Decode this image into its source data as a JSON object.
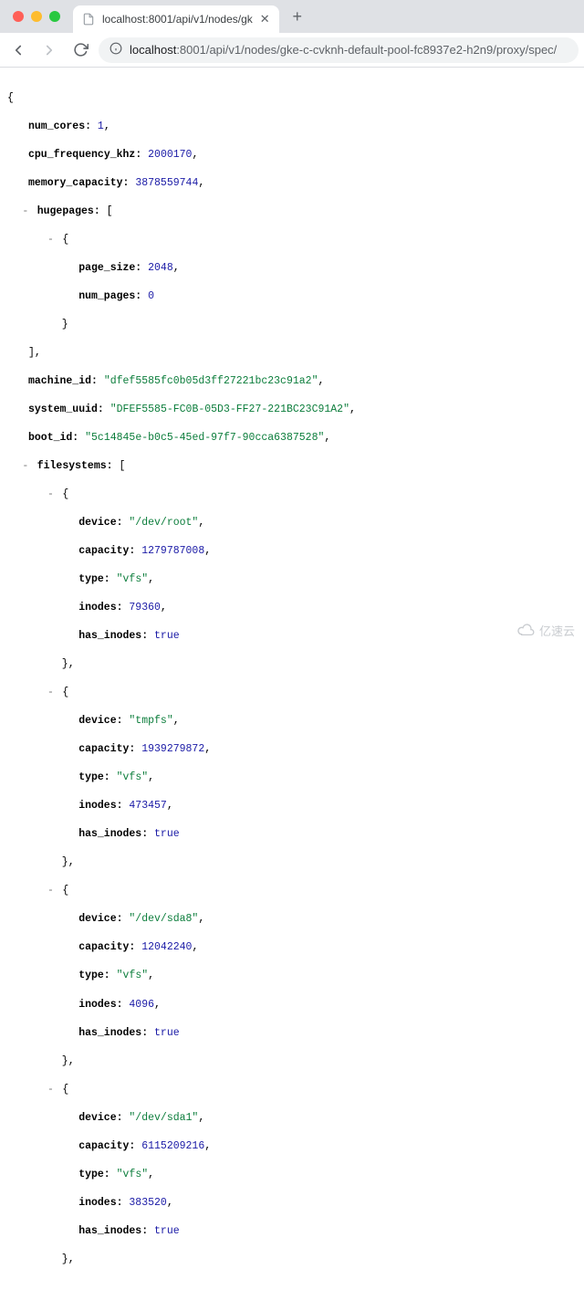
{
  "browser": {
    "tab_title": "localhost:8001/api/v1/nodes/gk",
    "url_host": "localhost",
    "url_port_path": ":8001/api/v1/nodes/gke-c-cvknh-default-pool-fc8937e2-h2n9/proxy/spec/"
  },
  "json": {
    "num_cores_key": "num_cores:",
    "num_cores": "1",
    "cpu_freq_key": "cpu_frequency_khz:",
    "cpu_freq": "2000170",
    "mem_cap_key": "memory_capacity:",
    "mem_cap": "3878559744",
    "hugepages_key": "hugepages:",
    "page_size_key": "page_size:",
    "page_size": "2048",
    "num_pages_key": "num_pages:",
    "num_pages": "0",
    "machine_id_key": "machine_id:",
    "machine_id": "\"dfef5585fc0b05d3ff27221bc23c91a2\"",
    "system_uuid_key": "system_uuid:",
    "system_uuid": "\"DFEF5585-FC0B-05D3-FF27-221BC23C91A2\"",
    "boot_id_key": "boot_id:",
    "boot_id": "\"5c14845e-b0c5-45ed-97f7-90cca6387528\"",
    "filesystems_key": "filesystems:",
    "device_key": "device:",
    "capacity_key": "capacity:",
    "type_key": "type:",
    "inodes_key": "inodes:",
    "has_inodes_key": "has_inodes:",
    "fs": [
      {
        "device": "\"/dev/root\"",
        "capacity": "1279787008",
        "type": "\"vfs\"",
        "inodes": "79360",
        "has_inodes": "true"
      },
      {
        "device": "\"tmpfs\"",
        "capacity": "1939279872",
        "type": "\"vfs\"",
        "inodes": "473457",
        "has_inodes": "true"
      },
      {
        "device": "\"/dev/sda8\"",
        "capacity": "12042240",
        "type": "\"vfs\"",
        "inodes": "4096",
        "has_inodes": "true"
      },
      {
        "device": "\"/dev/sda1\"",
        "capacity": "6115209216",
        "type": "\"vfs\"",
        "inodes": "383520",
        "has_inodes": "true"
      }
    ]
  },
  "watermark": "亿速云"
}
